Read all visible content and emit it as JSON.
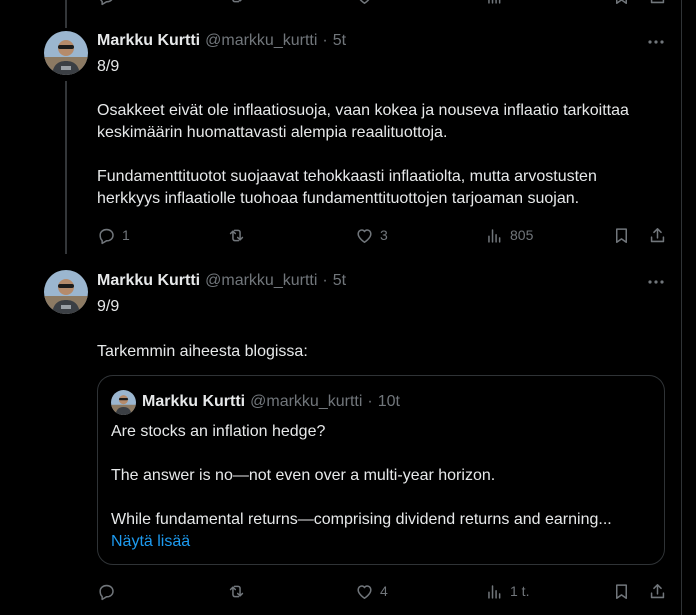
{
  "colors": {
    "background": "#000000",
    "text_primary": "#e7e9ea",
    "text_secondary": "#71767b",
    "border": "#2f3336",
    "link": "#1d9bf0"
  },
  "icons": {
    "reply": "reply-icon",
    "repost": "repost-icon",
    "like": "heart-icon",
    "views": "views-icon",
    "bookmark": "bookmark-icon",
    "share": "share-icon",
    "more": "more-icon"
  },
  "tweets": [
    {
      "author_name": "Markku Kurtti",
      "author_handle": "@markku_kurtti",
      "separator": "·",
      "time": "5t",
      "text": {
        "line1": "8/9",
        "p1_line1": "Osakkeet eivät ole inflaatiosuoja, vaan kokea ja nouseva inflaatio tarkoittaa",
        "p1_line2": "keskimäärin huomattavasti alempia reaalituottoja.",
        "p2_line1": "Fundamenttituotot suojaavat tehokkaasti inflaatiolta, mutta arvostusten",
        "p2_line2": "herkkyys inflaatiolle tuohoaa fundamenttituottojen tarjoaman suojan."
      },
      "stats": {
        "replies": "1",
        "reposts": "",
        "likes": "3",
        "views": "805"
      }
    },
    {
      "author_name": "Markku Kurtti",
      "author_handle": "@markku_kurtti",
      "separator": "·",
      "time": "5t",
      "text": {
        "line1": "9/9",
        "line2": "Tarkemmin aiheesta blogissa:"
      },
      "quote": {
        "author_name": "Markku Kurtti",
        "author_handle": "@markku_kurtti",
        "separator": "·",
        "time": "10t",
        "line1": "Are stocks an inflation hedge?",
        "line2": "The answer is no—not even over a multi-year horizon.",
        "line3": "While fundamental returns—comprising dividend returns and earning...",
        "show_more": "Näytä lisää"
      },
      "stats": {
        "replies": "",
        "reposts": "",
        "likes": "4",
        "views": "1 t."
      }
    }
  ]
}
